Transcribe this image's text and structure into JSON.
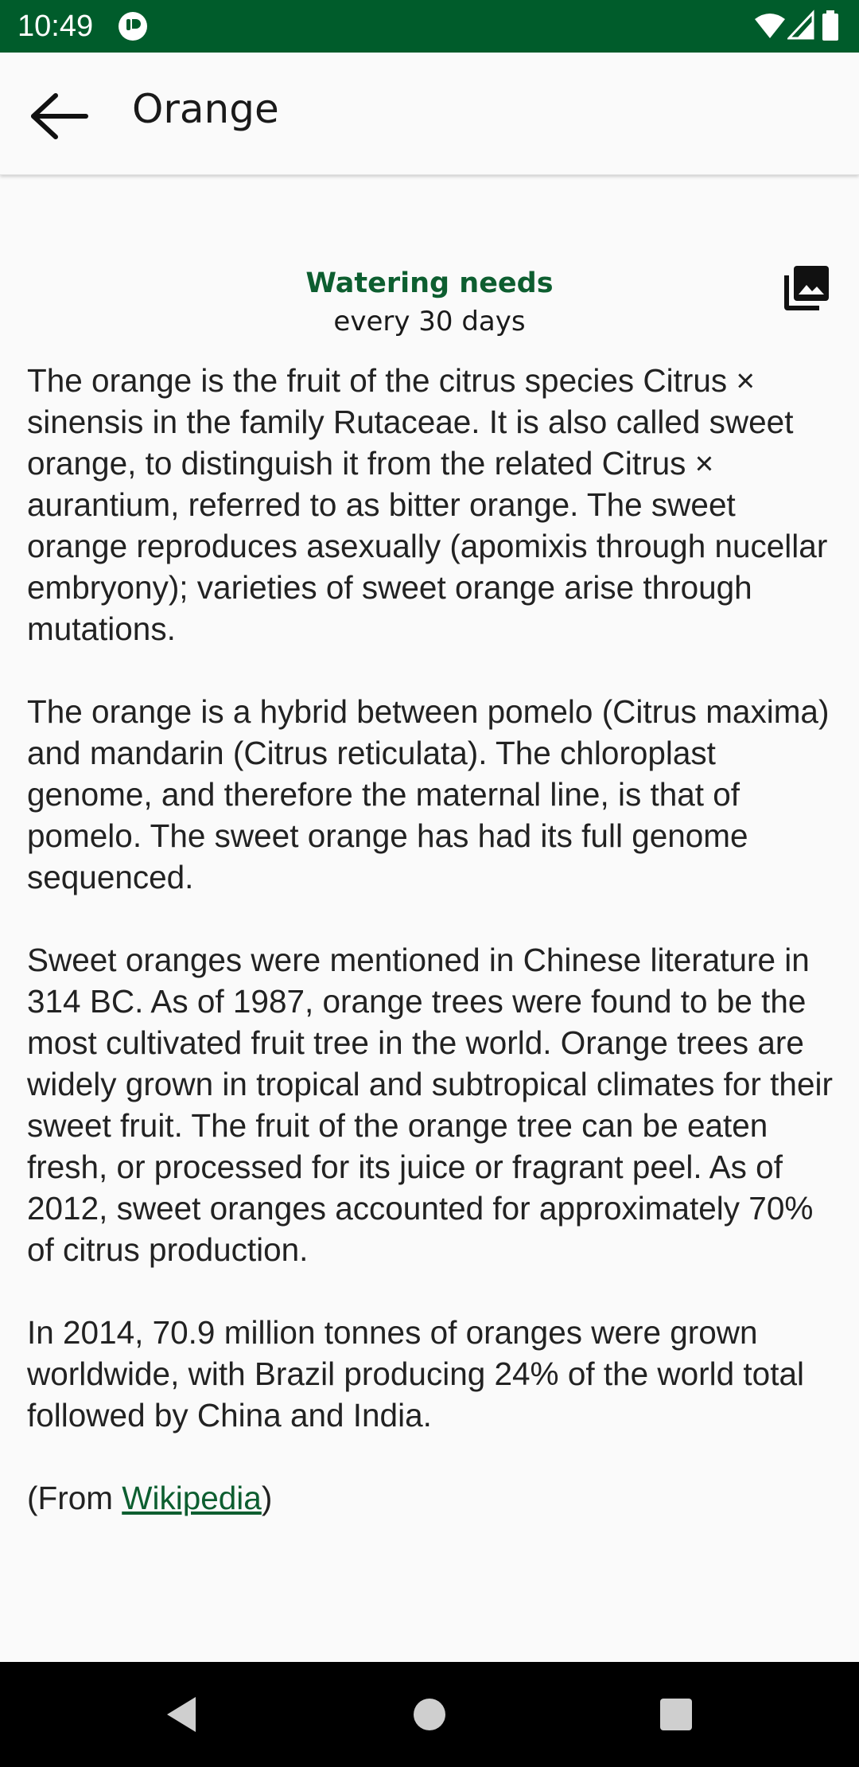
{
  "status_bar": {
    "time": "10:49",
    "background": "#005c2b"
  },
  "app_bar": {
    "back_icon": "arrow-back-icon",
    "title": "Orange"
  },
  "watering": {
    "title": "Watering needs",
    "value": "every 30 days",
    "accent": "#0d5e30"
  },
  "gallery_icon": "photo-library-icon",
  "description": {
    "paragraphs": [
      "The orange is the fruit of the citrus species Citrus × sinensis in the family Rutaceae. It is also called sweet orange, to distinguish it from the related Citrus × aurantium, referred to as bitter orange. The sweet orange reproduces asexually (apomixis through nucellar embryony); varieties of sweet orange arise through mutations.",
      "The orange is a hybrid between pomelo (Citrus maxima) and mandarin (Citrus reticulata). The chloroplast genome, and therefore the maternal line, is that of pomelo. The sweet orange has had its full genome sequenced.",
      "Sweet oranges were mentioned in Chinese literature in 314 BC. As of 1987, orange trees were found to be the most cultivated fruit tree in the world. Orange trees are widely grown in tropical and subtropical climates for their sweet fruit. The fruit of the orange tree can be eaten fresh, or processed for its juice or fragrant peel. As of 2012, sweet oranges accounted for approximately 70% of citrus production.",
      "In 2014, 70.9 million tonnes of oranges were grown worldwide, with Brazil producing 24% of the world total followed by China and India."
    ],
    "source_prefix": "(From ",
    "source_link": "Wikipedia",
    "source_suffix": ")"
  },
  "nav_bar": {
    "back": "nav-back-icon",
    "home": "nav-home-icon",
    "recents": "nav-recents-icon"
  }
}
